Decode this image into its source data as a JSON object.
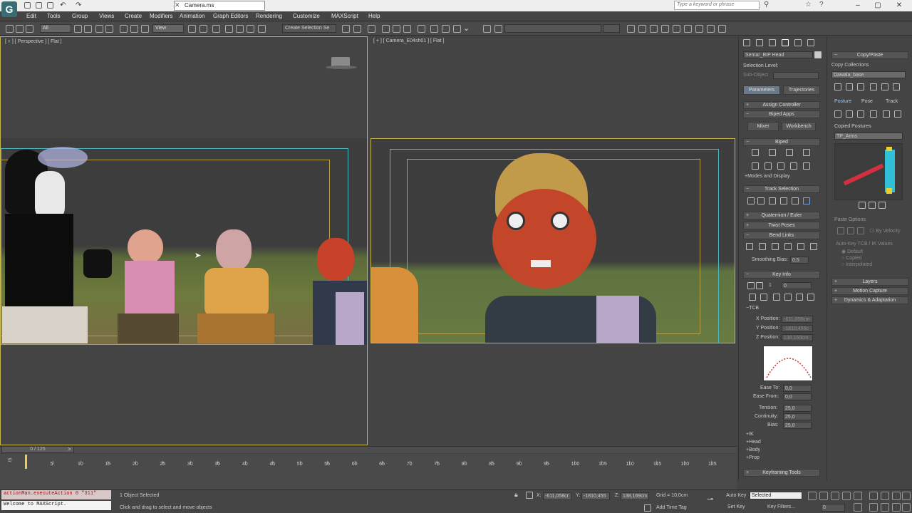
{
  "app": {
    "logo_letter": "G",
    "document_tab": "Camera.ms",
    "search_placeholder": "Type a keyword or phrase"
  },
  "menu": [
    "Edit",
    "Tools",
    "Group",
    "Views",
    "Create",
    "Modifiers",
    "Animation",
    "Graph Editors",
    "Rendering",
    "Customize",
    "MAXScript",
    "Help"
  ],
  "toolbar": {
    "filter_dropdown": "All",
    "ref_coord_dropdown": "View",
    "selection_set": "Create Selection Se"
  },
  "viewports": {
    "left_label": "[ + ] [ Perspective ] [ Flat ]",
    "right_label": "[ + ] [ Camera_E04sh01 ] [ Flat ]"
  },
  "command_panel": {
    "object_name": "Semar_BIP Head",
    "selection_level_label": "Selection Level:",
    "sub_object_label": "Sub-Object",
    "tab_parameters": "Parameters",
    "tab_trajectories": "Trajectories",
    "assign_controller": "Assign Controller",
    "biped_apps": "Biped Apps",
    "btn_mixer": "Mixer",
    "btn_workbench": "Workbench",
    "biped": "Biped",
    "modes_display": "Modes and Display",
    "track_selection": "Track Selection",
    "quaternion_euler": "Quaternion / Euler",
    "twist_poses": "Twist Poses",
    "bend_links": "Bend Links",
    "smoothing_bias_label": "Smoothing Bias:",
    "smoothing_bias_value": "0,5",
    "key_info": "Key Info",
    "key_number": "1",
    "key_value": "0",
    "tcb": "TCB",
    "x_position_label": "X Position:",
    "x_position_value": "-611,058cm",
    "y_position_label": "Y Position:",
    "y_position_value": "-1810,455c",
    "z_position_label": "Z Position:",
    "z_position_value": "138,169cm",
    "ease_to_label": "Ease To:",
    "ease_to_value": "0,0",
    "ease_from_label": "Ease From:",
    "ease_from_value": "0,0",
    "tension_label": "Tension:",
    "tension_value": "25,0",
    "continuity_label": "Continuity:",
    "continuity_value": "25,0",
    "bias_label": "Bias:",
    "bias_value": "25,0",
    "ik_label": "IK",
    "head_label": "Head",
    "body_label": "Body",
    "prop_label": "Prop",
    "keyframing_tools": "Keyframing Tools"
  },
  "side_panel": {
    "copy_paste": "Copy/Paste",
    "copy_collections_label": "Copy Collections",
    "collection_value": "Dawala_base",
    "tab_posture": "Posture",
    "tab_pose": "Pose",
    "tab_track": "Track",
    "copied_postures_label": "Copied Postures",
    "posture_value": "TP_Arms",
    "paste_options_label": "Paste Options",
    "by_velocity_label": "By Velocity",
    "auto_key_label": "Auto-Key TCB / IK Values",
    "opt_default": "Default",
    "opt_copied": "Copied",
    "opt_interpolated": "Interpolated",
    "layers": "Layers",
    "motion_capture": "Motion Capture",
    "dynamics_adaptation": "Dynamics & Adaptation"
  },
  "timeline": {
    "frame_readout": "0 / 125",
    "tick_labels": [
      "0",
      "5",
      "10",
      "15",
      "20",
      "25",
      "30",
      "35",
      "40",
      "45",
      "50",
      "55",
      "60",
      "65",
      "70",
      "75",
      "80",
      "85",
      "90",
      "95",
      "100",
      "105",
      "110",
      "115",
      "120",
      "125"
    ]
  },
  "status": {
    "listener_top": "actionMan.executeAction 0 \"311\"",
    "listener_bottom": "Welcome to MAXScript.",
    "selection_status": "1 Object Selected",
    "prompt": "Click and drag to select and move objects",
    "x_coord": "-611,058cr",
    "y_coord": "-1810,455",
    "z_coord": "138,169cm",
    "grid": "Grid = 10,0cm",
    "add_time_tag": "Add Time Tag",
    "auto_key": "Auto Key",
    "selected_dropdown": "Selected",
    "set_key": "Set Key",
    "key_filters": "Key Filters...",
    "frame_field": "0"
  },
  "colors": {
    "viewport_active_border": "#c8b64a",
    "safe_frame": "#4ab8c0"
  }
}
